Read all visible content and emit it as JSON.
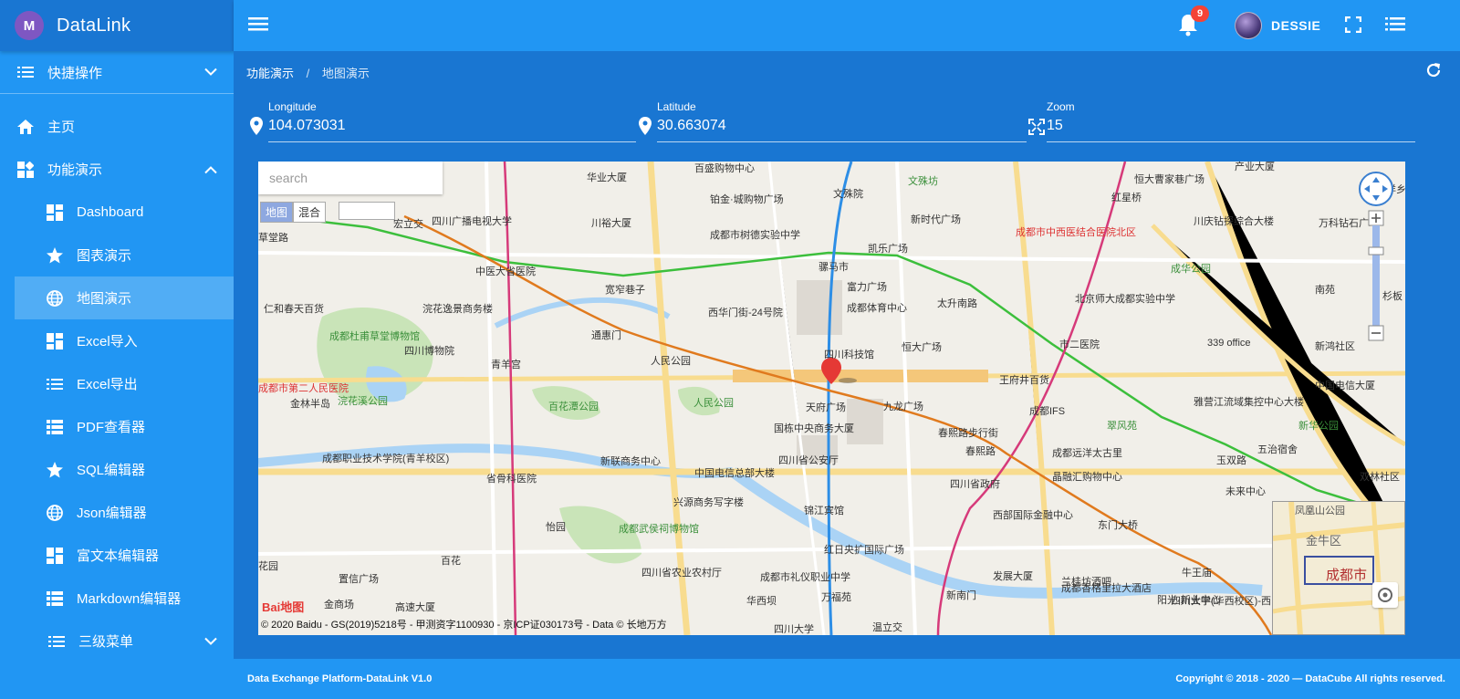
{
  "brand": {
    "name": "DataLink",
    "logo_letter": "M"
  },
  "sidebar": {
    "quick_ops": "快捷操作",
    "home": "主页",
    "feature_demo": "功能演示",
    "items": [
      {
        "label": "Dashboard",
        "icon": "dashboard-icon"
      },
      {
        "label": "图表演示",
        "icon": "star-icon"
      },
      {
        "label": "地图演示",
        "icon": "globe-icon"
      },
      {
        "label": "Excel导入",
        "icon": "dashboard-icon"
      },
      {
        "label": "Excel导出",
        "icon": "list-icon"
      },
      {
        "label": "PDF查看器",
        "icon": "table-icon"
      },
      {
        "label": "SQL编辑器",
        "icon": "star-icon"
      },
      {
        "label": "Json编辑器",
        "icon": "globe-icon"
      },
      {
        "label": "富文本编辑器",
        "icon": "dashboard-icon"
      },
      {
        "label": "Markdown编辑器",
        "icon": "table-icon"
      }
    ],
    "level3": "三级菜单"
  },
  "topbar": {
    "notification_count": "9",
    "username": "DESSIE"
  },
  "breadcrumb": {
    "parent": "功能演示",
    "separator": "/",
    "current": "地图演示"
  },
  "fields": {
    "longitude": {
      "label": "Longitude",
      "value": "104.073031"
    },
    "latitude": {
      "label": "Latitude",
      "value": "30.663074"
    },
    "zoom": {
      "label": "Zoom",
      "value": "15"
    }
  },
  "map": {
    "search_placeholder": "search",
    "type_map": "地图",
    "type_hybrid": "混合",
    "copyright": "© 2020 Baidu - GS(2019)5218号 - 甲测资字1100930 - 京ICP证030173号 - Data © 长地万方",
    "baidu_logo": "Bai地图",
    "overview_labels": [
      "凤凰山公园",
      "金牛区",
      "成都市"
    ],
    "pois": [
      {
        "t": "百盛购物中心"
      },
      {
        "t": "华业大厦"
      },
      {
        "t": "文殊院"
      },
      {
        "t": "文殊坊",
        "c": "green"
      },
      {
        "t": "恒大曹家巷广场"
      },
      {
        "t": "产业大厦"
      },
      {
        "t": "红星桥"
      },
      {
        "t": "藤洋乡"
      },
      {
        "t": "铂金·城购物广场"
      },
      {
        "t": "川裕大厦"
      },
      {
        "t": "新时代广场"
      },
      {
        "t": "四川广播电视大学"
      },
      {
        "t": "成都市树德实验中学"
      },
      {
        "t": "成都市中西医结合医院北区",
        "c": "red"
      },
      {
        "t": "川庆钻探综合大楼"
      },
      {
        "t": "万科钻石广场"
      },
      {
        "t": "中医大省医院"
      },
      {
        "t": "骡马市"
      },
      {
        "t": "凯乐广场"
      },
      {
        "t": "成华公园",
        "c": "green"
      },
      {
        "t": "宽窄巷子"
      },
      {
        "t": "富力广场"
      },
      {
        "t": "太升南路"
      },
      {
        "t": "北京师大成都实验中学"
      },
      {
        "t": "南苑"
      },
      {
        "t": "杉板"
      },
      {
        "t": "仁和春天百货"
      },
      {
        "t": "浣花逸景商务楼"
      },
      {
        "t": "西华门街-24号院"
      },
      {
        "t": "成都体育中心"
      },
      {
        "t": "成都杜甫草堂博物馆",
        "c": "green"
      },
      {
        "t": "通惠门"
      },
      {
        "t": "四川博物院"
      },
      {
        "t": "恒大广场"
      },
      {
        "t": "339 office"
      },
      {
        "t": "新鸿社区"
      },
      {
        "t": "市二医院"
      },
      {
        "t": "青羊宫"
      },
      {
        "t": "人民公园"
      },
      {
        "t": "四川科技馆"
      },
      {
        "t": "王府井百货"
      },
      {
        "t": "中国电信大厦"
      },
      {
        "t": "金林半岛"
      },
      {
        "t": "浣花溪公园",
        "c": "green"
      },
      {
        "t": "百花潭公园",
        "c": "green"
      },
      {
        "t": "人民公园",
        "c": "green"
      },
      {
        "t": "天府广场"
      },
      {
        "t": "九龙广场"
      },
      {
        "t": "成都IFS"
      },
      {
        "t": "雅营江流域集控中心大楼"
      },
      {
        "t": "翠风苑",
        "c": "green"
      },
      {
        "t": "新华公园",
        "c": "green"
      },
      {
        "t": "国栋中央商务大厦"
      },
      {
        "t": "春熙路步行街"
      },
      {
        "t": "成都职业技术学院(青羊校区)"
      },
      {
        "t": "新联商务中心"
      },
      {
        "t": "四川省公安厅"
      },
      {
        "t": "春熙路"
      },
      {
        "t": "成都远洋太古里"
      },
      {
        "t": "五治宿舍"
      },
      {
        "t": "玉双路"
      },
      {
        "t": "双林社区"
      },
      {
        "t": "省骨科医院"
      },
      {
        "t": "中国电信总部大楼"
      },
      {
        "t": "四川省政府"
      },
      {
        "t": "晶融汇购物中心"
      },
      {
        "t": "未来中心"
      },
      {
        "t": "兴源商务写字楼"
      },
      {
        "t": "锦江宾馆"
      },
      {
        "t": "怡园"
      },
      {
        "t": "成都武侯祠博物馆",
        "c": "green"
      },
      {
        "t": "西部国际金融中心"
      },
      {
        "t": "东门大桥"
      },
      {
        "t": "红日央扩国际广场"
      },
      {
        "t": "百花"
      },
      {
        "t": "四川省农业农村厅"
      },
      {
        "t": "成都市礼仪职业中学"
      },
      {
        "t": "发展大厦"
      },
      {
        "t": "兰桂坊酒吧"
      },
      {
        "t": "牛王庙"
      },
      {
        "t": "置信广场"
      },
      {
        "t": "新南门"
      },
      {
        "t": "成都香格里拉大酒店"
      },
      {
        "t": "阳光·新业中心"
      },
      {
        "t": "四川大学(华西校区)-西区"
      },
      {
        "t": "华西坝"
      },
      {
        "t": "万福苑"
      },
      {
        "t": "高速大厦"
      },
      {
        "t": "四川大学"
      },
      {
        "t": "温立交"
      },
      {
        "t": "草堂路"
      },
      {
        "t": "宏立交"
      },
      {
        "t": "金商场"
      },
      {
        "t": "花园"
      },
      {
        "t": "成都市第二人民医院",
        "c": "red"
      }
    ]
  },
  "footer": {
    "left": "Data Exchange Platform-DataLink V1.0",
    "right_prefix": "Copyright © 2018 - 2020 — ",
    "right_brand": "DataCube",
    "right_suffix": " All rights reserved."
  },
  "colors": {
    "primary": "#2196f3",
    "primary_dark": "#1976d2",
    "badge": "#f44336",
    "marker": "#e53935"
  }
}
